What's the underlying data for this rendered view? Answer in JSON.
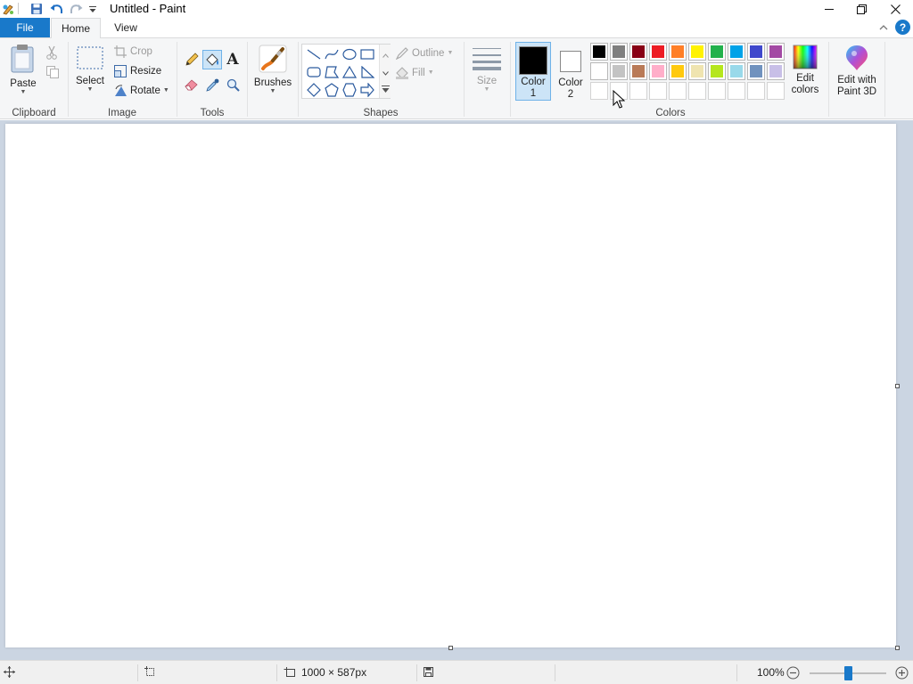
{
  "window": {
    "title": "Untitled - Paint",
    "controls": {
      "minimize": "minimize",
      "restore": "restore",
      "close": "close"
    }
  },
  "tabs": {
    "file": "File",
    "home": "Home",
    "view": "View"
  },
  "help": "?",
  "ribbon": {
    "clipboard": {
      "group": "Clipboard",
      "paste": "Paste"
    },
    "image": {
      "group": "Image",
      "select": "Select",
      "crop": "Crop",
      "resize": "Resize",
      "rotate": "Rotate"
    },
    "tools": {
      "group": "Tools"
    },
    "brushes": {
      "label": "Brushes"
    },
    "shapes": {
      "group": "Shapes",
      "outline": "Outline",
      "fill": "Fill"
    },
    "size": {
      "label": "Size"
    },
    "colors": {
      "group": "Colors",
      "color1_line1": "Color",
      "color1_line2": "1",
      "color2_line1": "Color",
      "color2_line2": "2",
      "color1_value": "#000000",
      "color2_value": "#ffffff",
      "edit_line1": "Edit",
      "edit_line2": "colors",
      "palette_row1": [
        "#000000",
        "#7f7f7f",
        "#880015",
        "#ed1c24",
        "#ff7f27",
        "#fff200",
        "#22b14c",
        "#00a2e8",
        "#3f48cc",
        "#a349a4"
      ],
      "palette_row2": [
        "#ffffff",
        "#c3c3c3",
        "#b97a57",
        "#ffaec9",
        "#ffc90e",
        "#efe4b0",
        "#b5e61d",
        "#99d9ea",
        "#7092be",
        "#c8bfe7"
      ]
    },
    "paint3d": {
      "line1": "Edit with",
      "line2": "Paint 3D"
    }
  },
  "status": {
    "canvas_size": "1000 × 587px",
    "zoom": "100%",
    "zoom_fraction": 0.5
  }
}
